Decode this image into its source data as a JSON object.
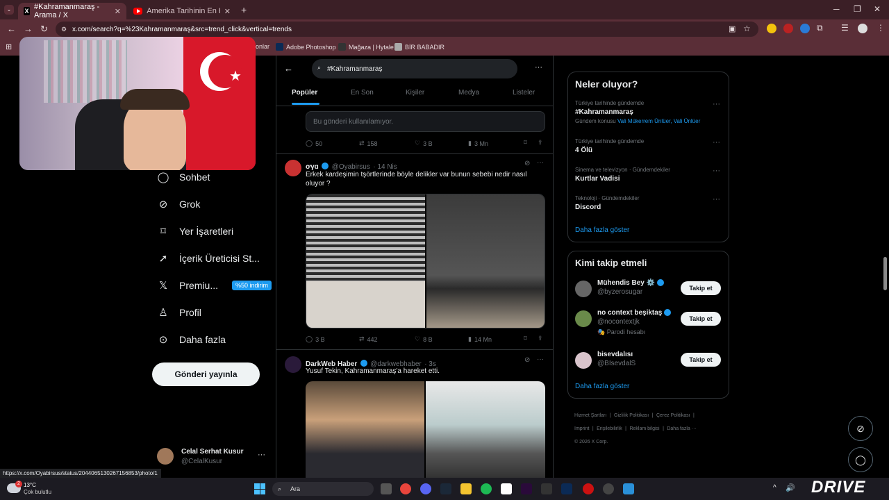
{
  "browser": {
    "tabs": [
      {
        "label": "#Kahramanmaraş - Arama / X",
        "active": true
      },
      {
        "label": "Amerika Tarihinin En Kanlı Lise",
        "active": false
      }
    ],
    "url": "x.com/search?q=%23Kahramanmaraş&src=trend_click&vertical=trends",
    "bookmarks": [
      "onlar",
      "Adobe Photoshop",
      "Mağaza | Hytale",
      "BİR BABADIR"
    ]
  },
  "left_nav": {
    "items": [
      {
        "label": "Sohbet",
        "icon": "chat-bubble-icon"
      },
      {
        "label": "Grok",
        "icon": "grok-icon"
      },
      {
        "label": "Yer İşaretleri",
        "icon": "bookmark-icon"
      },
      {
        "label": "İçerik Üreticisi St...",
        "icon": "rocket-icon"
      },
      {
        "label": "Premiu...",
        "icon": "x-logo-icon"
      },
      {
        "label": "Profil",
        "icon": "person-icon"
      },
      {
        "label": "Daha fazla",
        "icon": "more-circle-icon"
      }
    ],
    "premium_badge": "%50 indirim",
    "post_button": "Gönderi yayınla",
    "account": {
      "name": "Celal Serhat Kusur",
      "handle": "@CelalKusur"
    }
  },
  "center": {
    "search_value": "#Kahramanmaraş",
    "tabs": [
      "Popüler",
      "En Son",
      "Kişiler",
      "Medya",
      "Listeler"
    ],
    "unavailable_post": "Bu gönderi kullanılamıyor.",
    "stats1": {
      "replies": "50",
      "reposts": "158",
      "likes": "3 B",
      "views": "3 Mn"
    },
    "tweet1": {
      "name": "ơγɑ",
      "handle": "@Oyabirsus",
      "time": "· 14 Nis",
      "text": "Erkek kardeşimin tşörtlerinde böyle delikler var bunun sebebi nedir nasıl oluyor ?",
      "stats": {
        "replies": "3 B",
        "reposts": "442",
        "likes": "8 B",
        "views": "14 Mn"
      }
    },
    "tweet2": {
      "name": "DarkWeb Haber",
      "handle": "@darkwebhaber",
      "time": "· 3s",
      "text": "Yusuf Tekin, Kahramanmaraş'a hareket etti."
    }
  },
  "right": {
    "trends_title": "Neler oluyor?",
    "trends": [
      {
        "context": "Türkiye tarihinde gündemde",
        "name": "#Kahramanmaraş",
        "extra_prefix": "Gündem konusu",
        "extra_link": "Vali Mükerrem Ünlüer, Vali Ünlüer"
      },
      {
        "context": "Türkiye tarihinde gündemde",
        "name": "4 Ölü"
      },
      {
        "context": "Sinema ve televizyon · Gündemdekiler",
        "name": "Kurtlar Vadisi"
      },
      {
        "context": "Teknoloji · Gündemdekiler",
        "name": "Discord"
      }
    ],
    "trends_more": "Daha fazla göster",
    "follow_title": "Kimi takip etmeli",
    "follow": [
      {
        "name": "Mühendis Bey ⚙️",
        "handle": "@byzerosugar",
        "note": ""
      },
      {
        "name": "no context beşiktaş",
        "handle": "@nocontextjk",
        "note": "Parodi hesabı"
      },
      {
        "name": "bisevdalısı",
        "handle": "@BIsevdalS",
        "note": ""
      }
    ],
    "follow_button": "Takip et",
    "follow_more": "Daha fazla göster",
    "footer": [
      "Hizmet Şartları",
      "Gizlilik Politikası",
      "Çerez Politikası",
      "Imprint",
      "Erişilebilirlik",
      "Reklam bilgisi",
      "Daha fazla ···",
      "© 2026 X Corp."
    ]
  },
  "status_url": "https://x.com/Oyabirsus/status/2044065130267156853/photo/1",
  "taskbar": {
    "weather_temp": "13°C",
    "weather_desc": "Çok bulutlu",
    "search_label": "Ara",
    "notif_count": "2",
    "brand": "DRIVE"
  }
}
